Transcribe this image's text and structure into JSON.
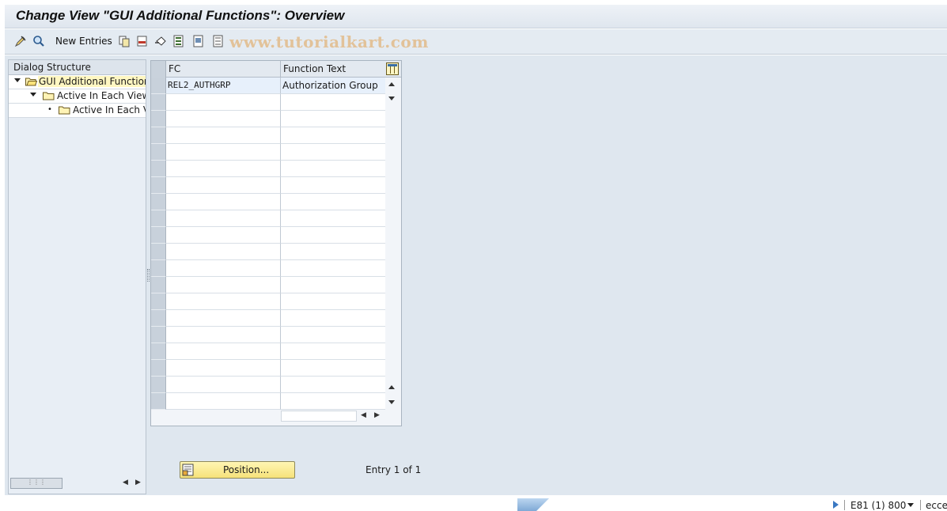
{
  "window": {
    "title": "Change View \"GUI Additional Functions\": Overview"
  },
  "toolbar": {
    "icons": [
      "edit-display-icon",
      "find-icon",
      "copy-icon",
      "delete-icon",
      "undo-icon",
      "select-all-icon",
      "select-block-icon",
      "deselect-all-icon"
    ],
    "new_entries_label": "New Entries",
    "watermark": "www.tutorialkart.com"
  },
  "dialog_structure": {
    "header": "Dialog Structure",
    "items": [
      {
        "label": "GUI Additional Functions",
        "level": 0,
        "expanded": true,
        "selected": true,
        "icon": "open-folder-icon"
      },
      {
        "label": "Active In Each View",
        "level": 1,
        "expanded": true,
        "selected": false,
        "icon": "folder-icon"
      },
      {
        "label": "Active In Each Vi",
        "level": 2,
        "expanded": false,
        "selected": false,
        "icon": "folder-icon"
      }
    ]
  },
  "table": {
    "columns": [
      "FC",
      "Function Text"
    ],
    "rows": [
      {
        "fc": "REL2_AUTHGRP",
        "function_text": "Authorization Group"
      }
    ],
    "empty_rows": 19
  },
  "position_button": {
    "label": "Position..."
  },
  "entry_info": "Entry 1 of 1",
  "status_bar": {
    "system": "E81 (1) 800",
    "server": "ecce"
  },
  "colors": {
    "selected_tree_item": "#fff7c2",
    "filled_row": "#e7f0fb",
    "position_button": "#f6e27a",
    "watermark": "#e0a050"
  }
}
